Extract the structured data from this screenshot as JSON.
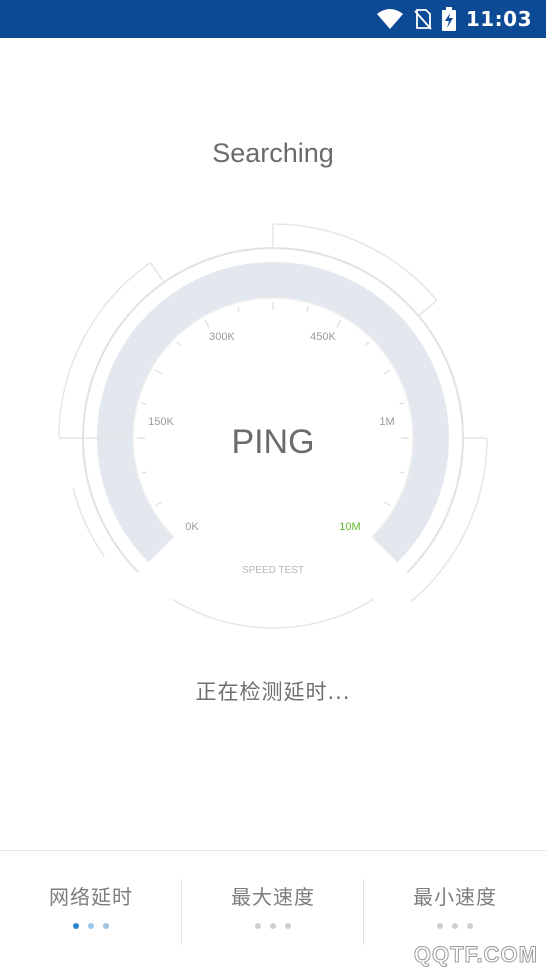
{
  "status_bar": {
    "time": "11:03",
    "icons": [
      "wifi-icon",
      "no-sim-icon",
      "battery-charging-icon"
    ],
    "color": "#0d4a96"
  },
  "title": "Searching",
  "gauge": {
    "center_label": "PING",
    "sub_label": "SPEED TEST",
    "scale_labels": [
      "0K",
      "150K",
      "300K",
      "450K",
      "1M",
      "10M"
    ],
    "highlight_label": "10M",
    "highlight_color": "#5cb82c",
    "band_color": "#e3e8ef"
  },
  "status_text": "正在检测延时...",
  "bottom_nav": {
    "tabs": [
      {
        "label": "网络延时",
        "active": true
      },
      {
        "label": "最大速度",
        "active": false
      },
      {
        "label": "最小速度",
        "active": false
      }
    ]
  },
  "watermark": "QQTF.COM"
}
